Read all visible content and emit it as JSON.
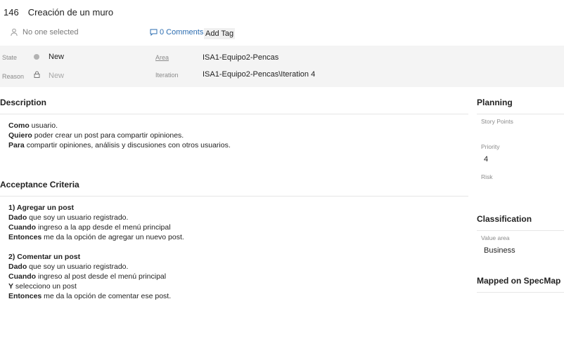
{
  "work_item": {
    "id": "146",
    "title": "Creación de un muro",
    "assignee": "No one selected",
    "comments": "0 Comments",
    "add_tag": "Add Tag"
  },
  "fields": {
    "state_label": "State",
    "state_value": "New",
    "reason_label": "Reason",
    "reason_value": "New",
    "area_label": "Area",
    "area_value": "ISA1-Equipo2-Pencas",
    "iteration_label": "Iteration",
    "iteration_value": "ISA1-Equipo2-Pencas\\Iteration 4"
  },
  "description": {
    "heading": "Description",
    "lines": [
      {
        "bold": "Como",
        "text": " usuario."
      },
      {
        "bold": "Quiero",
        "text": " poder crear un post para compartir opiniones."
      },
      {
        "bold": "Para",
        "text": " compartir opiniones, análisis y discusiones con otros usuarios."
      }
    ]
  },
  "acceptance": {
    "heading": "Acceptance Criteria",
    "block1": [
      {
        "bold": "1) Agregar un post",
        "text": ""
      },
      {
        "bold": "Dado",
        "text": " que soy un usuario registrado."
      },
      {
        "bold": "Cuando",
        "text": " ingreso a la app desde el menú principal"
      },
      {
        "bold": "Entonces",
        "text": " me da la opción de agregar un nuevo post."
      }
    ],
    "block2": [
      {
        "bold": "2) Comentar un post",
        "text": ""
      },
      {
        "bold": "Dado",
        "text": " que soy un usuario registrado."
      },
      {
        "bold": "Cuando",
        "text": " ingreso al post desde el menú principal"
      },
      {
        "bold": "Y",
        "text": " selecciono un post"
      },
      {
        "bold": "Entonces",
        "text": " me da la opción de comentar ese post."
      }
    ]
  },
  "planning": {
    "heading": "Planning",
    "story_points_label": "Story Points",
    "story_points_value": "",
    "priority_label": "Priority",
    "priority_value": "4",
    "risk_label": "Risk",
    "risk_value": ""
  },
  "classification": {
    "heading": "Classification",
    "value_area_label": "Value area",
    "value_area_value": "Business"
  },
  "mapped": {
    "heading": "Mapped on SpecMap"
  },
  "colors": {
    "link": "#2b6cb0",
    "band": "#f4f4f4",
    "muted": "#8a8a8a"
  }
}
